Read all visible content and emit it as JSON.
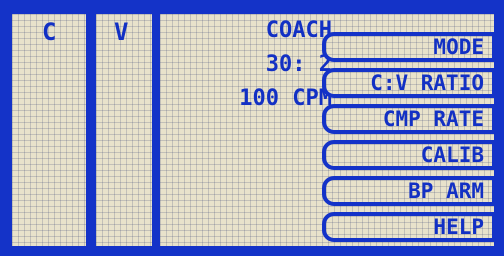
{
  "columns": {
    "c_label": "C",
    "v_label": "V"
  },
  "status": {
    "mode": "COACH",
    "ratio": "30: 2",
    "rate": "100 CPM"
  },
  "menu": [
    {
      "label": "MODE"
    },
    {
      "label": "C:V RATIO"
    },
    {
      "label": "CMP RATE"
    },
    {
      "label": "CALIB"
    },
    {
      "label": "BP ARM"
    },
    {
      "label": "HELP"
    }
  ],
  "colors": {
    "background": "#1433c8",
    "panel": "#e8e2cb",
    "text": "#1230c4"
  }
}
